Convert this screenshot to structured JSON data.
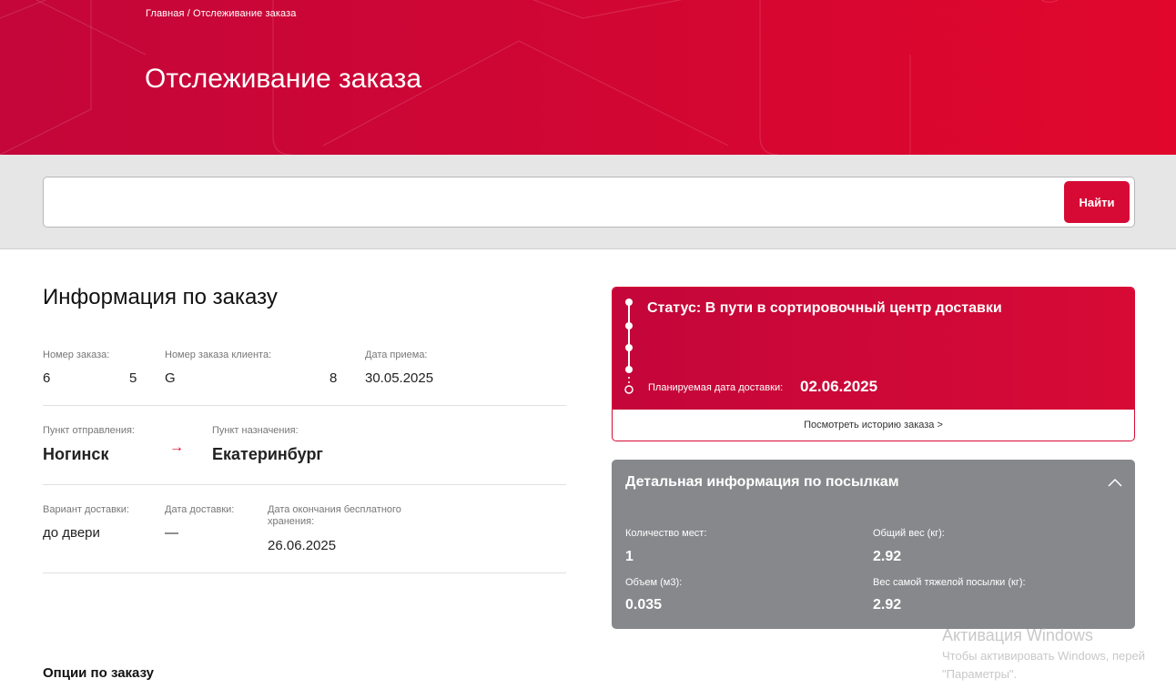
{
  "header": {
    "breadcrumb": "Главная / Отслеживание заказа",
    "title": "Отслеживание заказа"
  },
  "search": {
    "value": "",
    "button_label": "Найти"
  },
  "order_info": {
    "title": "Информация по заказу",
    "order_number": {
      "label": "Номер заказа:",
      "value_start": "6",
      "value_end": "5"
    },
    "client_order_number": {
      "label": "Номер заказа клиента:",
      "value_start": "G",
      "value_end": "8"
    },
    "accept_date": {
      "label": "Дата приема:",
      "value": "30.05.2025"
    },
    "origin": {
      "label": "Пункт отправления:",
      "value": "Ногинск"
    },
    "destination": {
      "label": "Пункт назначения:",
      "value": "Екатеринбург"
    },
    "route_arrow": "→",
    "delivery_variant": {
      "label": "Вариант доставки:",
      "value": "до двери"
    },
    "delivery_date": {
      "label": "Дата доставки:",
      "value": "—"
    },
    "storage_end": {
      "label_line1": "Дата окончания бесплатного",
      "label_line2": "хранения:",
      "value": "26.06.2025"
    }
  },
  "options": {
    "title": "Опции по заказу"
  },
  "status": {
    "text": "Статус: В пути в сортировочный центр доставки",
    "planned_label": "Планируемая дата доставки:",
    "planned_date": "02.06.2025",
    "history_link": "Посмотреть историю заказа >"
  },
  "parcels": {
    "title": "Детальная информация по посылкам",
    "places": {
      "label": "Количество мест:",
      "value": "1"
    },
    "total_weight": {
      "label": "Общий вес (кг):",
      "value": "2.92"
    },
    "volume": {
      "label": "Объем (м3):",
      "value": "0.035"
    },
    "heaviest": {
      "label": "Вес самой тяжелой посылки (кг):",
      "value": "2.92"
    }
  },
  "watermark": {
    "line1": "Активация Windows",
    "line2": "Чтобы активировать Windows, перей",
    "line3": "\"Параметры\"."
  },
  "colors": {
    "brand_red": "#d70a35",
    "parcel_gray": "#87888b",
    "band_gray": "#e6e6e7"
  }
}
